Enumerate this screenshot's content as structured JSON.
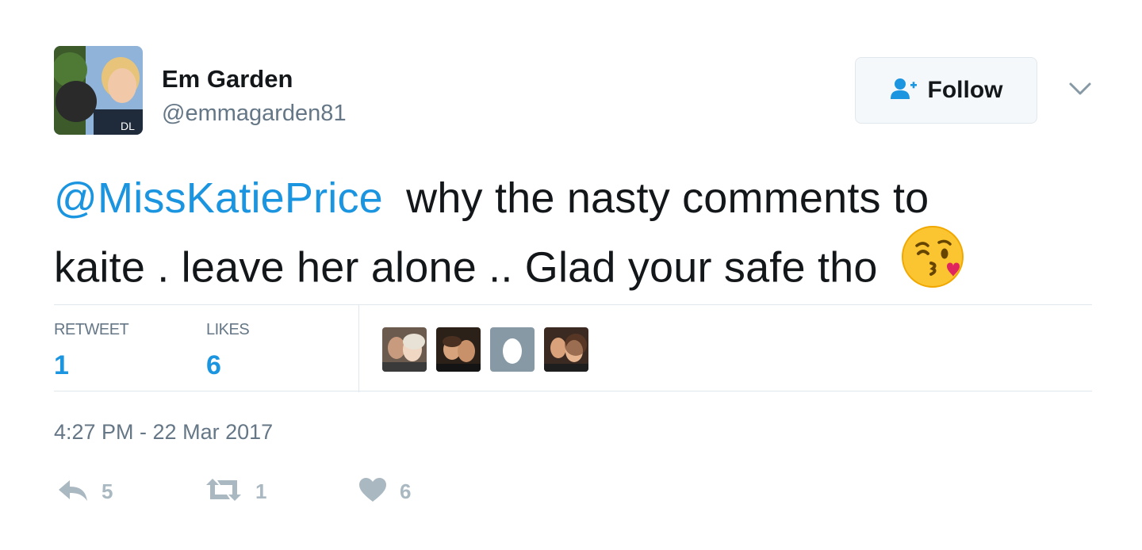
{
  "user": {
    "name": "Em Garden",
    "handle": "@emmagarden81"
  },
  "follow_button": {
    "label": "Follow",
    "icon": "follow-user-icon"
  },
  "tweet": {
    "mention": "@MissKatiePrice",
    "text_line1": "why the nasty comments to",
    "text_line2": "kaite . leave her alone .. Glad your safe tho",
    "emoji": "face-throwing-kiss"
  },
  "stats": {
    "retweets_label": "RETWEET",
    "retweets_count": "1",
    "likes_label": "LIKES",
    "likes_count": "6"
  },
  "timestamp": "4:27 PM - 22 Mar 2017",
  "actions": {
    "reply_count": "5",
    "retweet_count": "1",
    "like_count": "6"
  },
  "colors": {
    "link": "#1b95e0",
    "muted": "#657786",
    "icon": "#aab8c2",
    "border": "#e1e8ed"
  }
}
